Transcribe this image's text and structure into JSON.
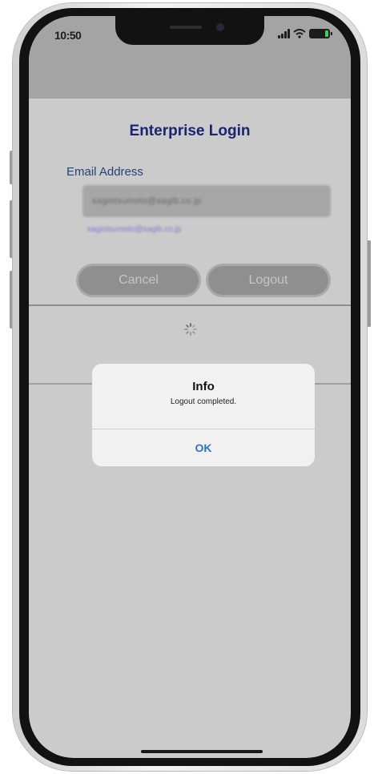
{
  "status_bar": {
    "time": "10:50",
    "battery_color": "#3fcf5a"
  },
  "login": {
    "title": "Enterprise Login",
    "email_label": "Email Address",
    "email_value": "sagiotsumoto@sagib.co.jp",
    "email_link": "sagiotsumoto@sagib.co.jp",
    "cancel_label": "Cancel",
    "logout_label": "Logout"
  },
  "alert": {
    "title": "Info",
    "message": "Logout completed.",
    "ok_label": "OK",
    "ok_color": "#2f6fd0"
  },
  "icons": [
    "signal-icon",
    "wifi-icon",
    "battery-icon",
    "spinner-icon"
  ]
}
